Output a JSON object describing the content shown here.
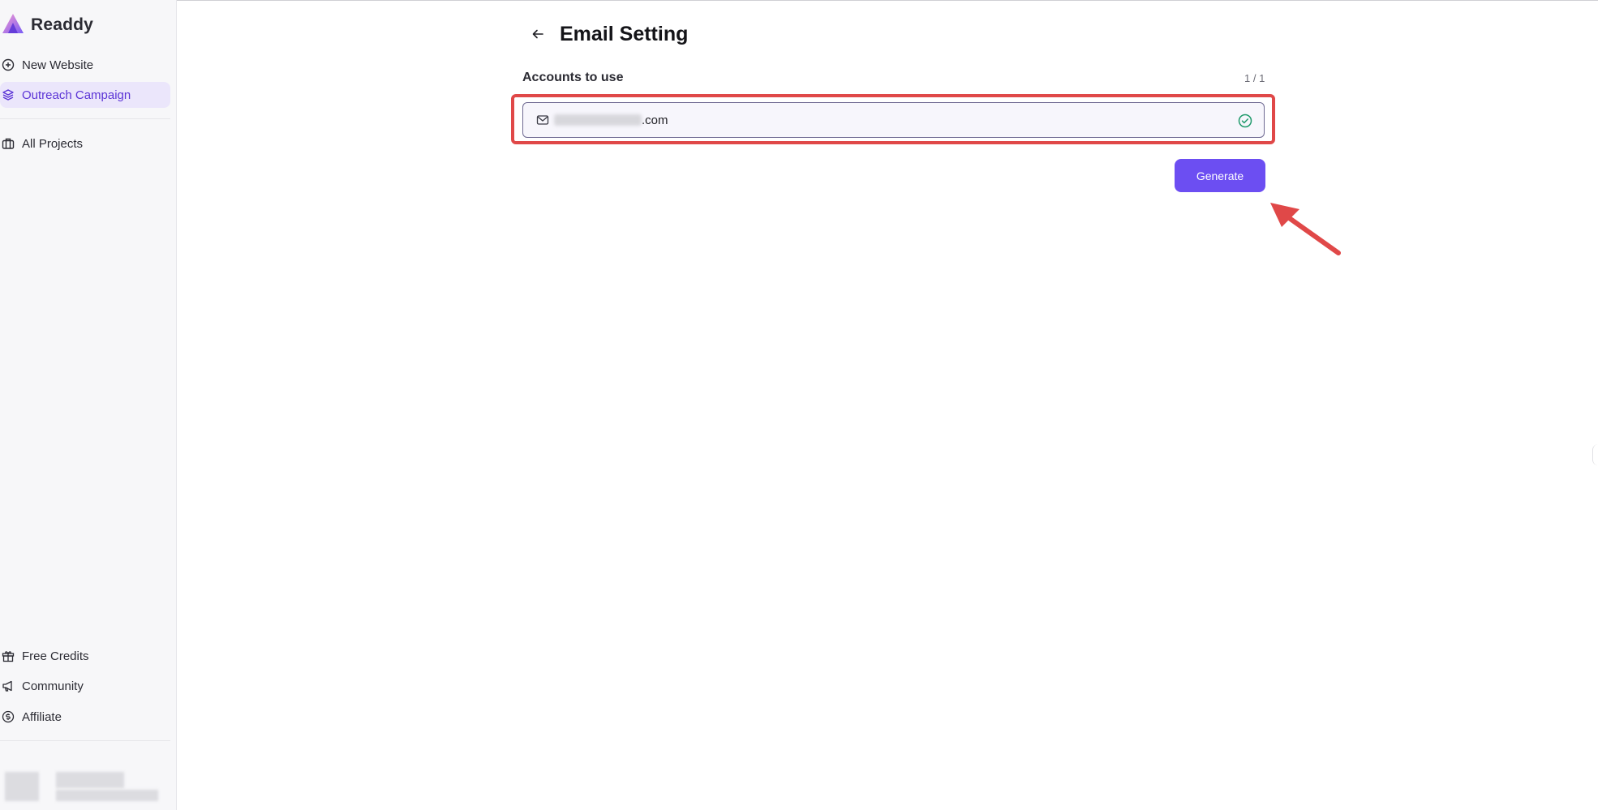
{
  "app": {
    "name": "Readdy"
  },
  "sidebar": {
    "items": [
      {
        "label": "New Website",
        "icon": "plus-circle-icon"
      },
      {
        "label": "Outreach Campaign",
        "icon": "layers-icon",
        "active": true
      },
      {
        "label": "All Projects",
        "icon": "briefcase-icon"
      }
    ],
    "footer_items": [
      {
        "label": "Free Credits",
        "icon": "gift-icon"
      },
      {
        "label": "Community",
        "icon": "megaphone-icon"
      },
      {
        "label": "Affiliate",
        "icon": "dollar-circle-icon"
      }
    ]
  },
  "page": {
    "title": "Email Setting",
    "section_label": "Accounts to use",
    "count": "1 / 1",
    "account": {
      "email_suffix": ".com",
      "verified": true
    },
    "generate_label": "Generate"
  },
  "colors": {
    "accent": "#6c4ef2",
    "active_bg": "#ebe6fb",
    "active_text": "#5b34d6",
    "highlight": "#e04848",
    "verified": "#1f9a6b"
  }
}
